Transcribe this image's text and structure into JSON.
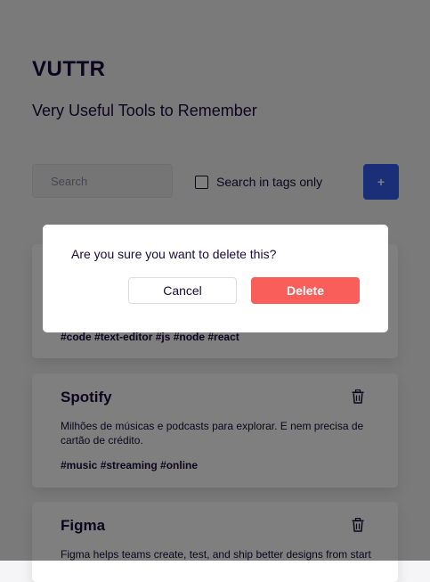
{
  "header": {
    "title": "VUTTR",
    "subtitle": "Very Useful Tools to Remember"
  },
  "toolbar": {
    "search_placeholder": "Search",
    "search_value": "",
    "tags_only_label": "Search in tags only",
    "tags_only_checked": false,
    "add_label": "+"
  },
  "tools": [
    {
      "title": "",
      "description": "",
      "tags": "#code #text-editor #js #node #react"
    },
    {
      "title": "Spotify",
      "description": "Milhões de músicas e podcasts para explorar. E nem precisa de cartão de crédito.",
      "tags": "#music #streaming #online"
    },
    {
      "title": "Figma",
      "description": "Figma helps teams create, test, and ship better designs from start",
      "tags": ""
    }
  ],
  "modal": {
    "question": "Are you sure you want to delete this?",
    "cancel_label": "Cancel",
    "delete_label": "Delete"
  },
  "icons": {
    "trash": "trash-icon"
  },
  "colors": {
    "background": "#f5f4f6",
    "text": "#170c3a",
    "primary": "#365df0",
    "danger": "#f95e5a",
    "overlay": "rgba(0,0,0,0.5)"
  }
}
